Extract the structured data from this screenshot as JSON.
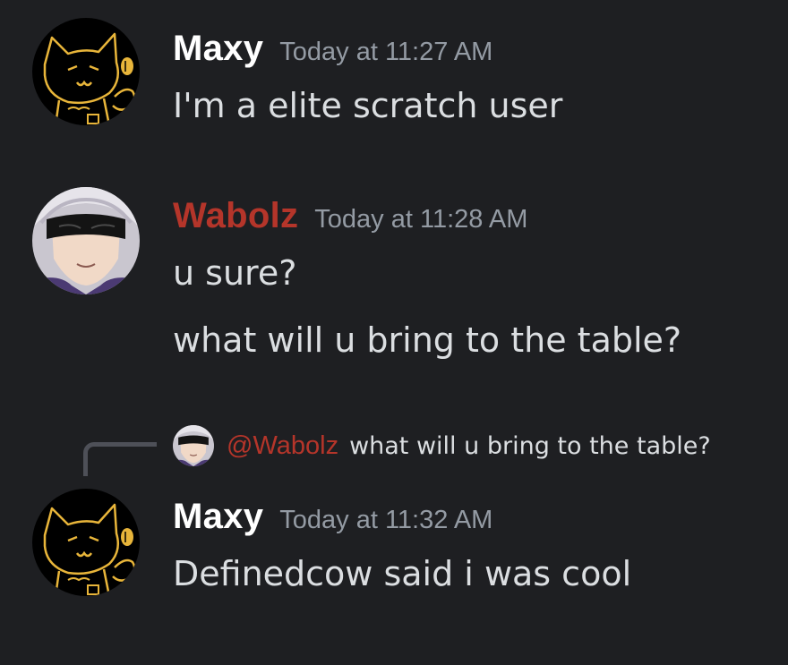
{
  "theme": {
    "background": "#1e1f22",
    "text": "#dbdee1",
    "muted": "#949ba4",
    "maxy_color": "#ffffff",
    "wabolz_color": "#b5352a"
  },
  "messages": [
    {
      "author": "Maxy",
      "timestamp": "Today at 11:27 AM",
      "lines": [
        "I'm a elite scratch user"
      ]
    },
    {
      "author": "Wabolz",
      "timestamp": "Today at 11:28 AM",
      "lines": [
        "u sure?",
        "what will u bring to the table?"
      ]
    },
    {
      "reply_to": {
        "mention": "@Wabolz",
        "text": "what will u bring to the table?"
      },
      "author": "Maxy",
      "timestamp": "Today at 11:32 AM",
      "lines": [
        "Definedcow said i was cool"
      ]
    }
  ]
}
